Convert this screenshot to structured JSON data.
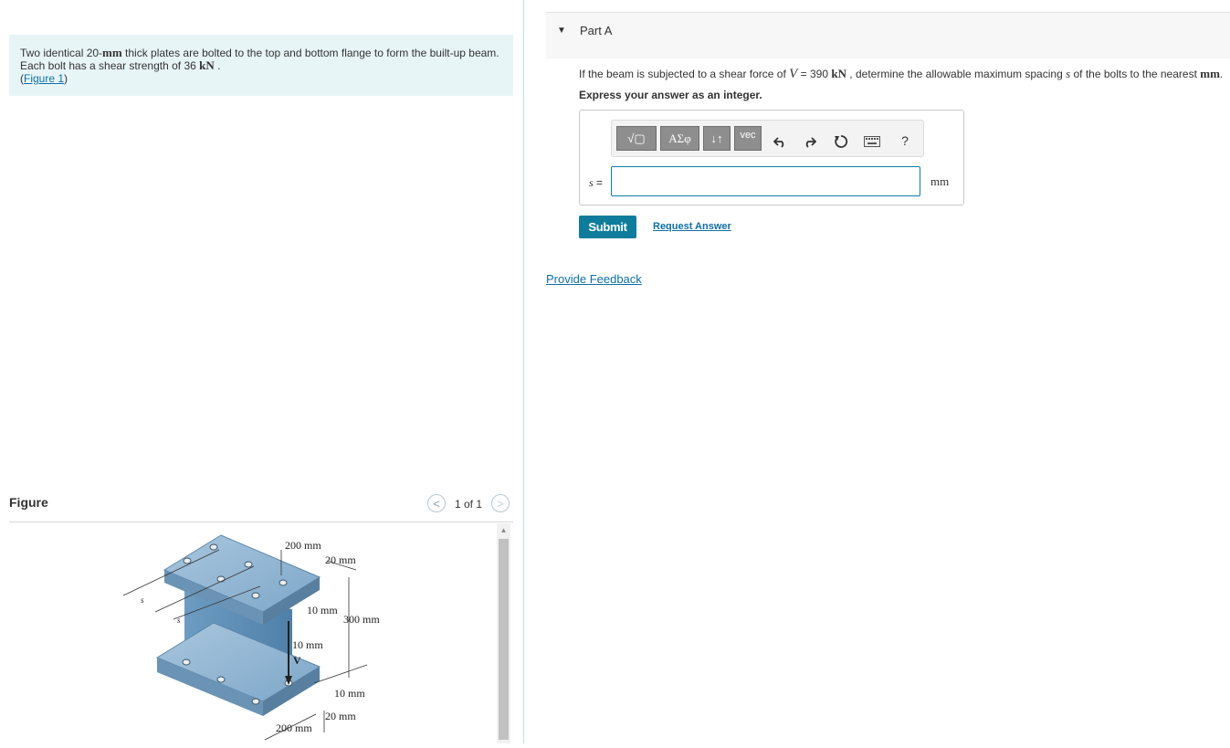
{
  "problem": {
    "line1_a": "Two identical 20-",
    "line1_unit": "mm",
    "line1_b": " thick plates are bolted to the top and bottom flange to form the built-up beam.",
    "line2_a": "Each bolt has a shear strength of 36 ",
    "line2_unit": "kN",
    "line2_b": " .",
    "figure_link_open": "(",
    "figure_link": "Figure 1",
    "figure_link_close": ")"
  },
  "figure_panel": {
    "title": "Figure",
    "pager": "1 of 1",
    "prev_glyph": "<",
    "next_glyph": ">",
    "labels": {
      "top_width": "200 mm",
      "top_plate": "20 mm",
      "web_upper": "10 mm",
      "height": "300 mm",
      "web_lower": "10 mm",
      "shear": "V",
      "bottom_flange": "10 mm",
      "bottom_plate": "20 mm",
      "bottom_width": "200 mm",
      "spacing_1": "s",
      "spacing_2": "s"
    }
  },
  "part": {
    "caret": "▼",
    "title": "Part A",
    "question_a": "If the beam is subjected to a shear force of ",
    "question_var": "V",
    "question_b": " = 390 ",
    "question_unit": "kN",
    "question_c": " , determine the allowable maximum spacing ",
    "question_s": "s",
    "question_d": " of the bolts to the nearest ",
    "question_unit2": "mm",
    "question_e": ".",
    "instruction": "Express your answer as an integer."
  },
  "toolbar": {
    "templates_label": "√▢",
    "greek_label": "ΑΣφ",
    "arrows_label": "↓↑",
    "vec_label": "vec",
    "help_label": "?"
  },
  "answer": {
    "var_label": "s",
    "equals": " =",
    "value": "",
    "unit": "mm"
  },
  "actions": {
    "submit": "Submit",
    "request_answer": "Request Answer",
    "provide_feedback": "Provide Feedback"
  },
  "colors": {
    "accent": "#0f7c9c",
    "link": "#0f6fa8",
    "problem_bg": "#e8f5f7",
    "beam_fill": "#7aa6c8",
    "beam_dark": "#4d7ea4"
  }
}
